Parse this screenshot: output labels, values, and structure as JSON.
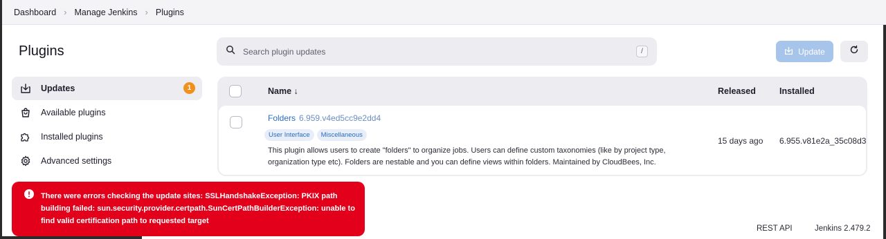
{
  "breadcrumb": [
    "Dashboard",
    "Manage Jenkins",
    "Plugins"
  ],
  "page_title": "Plugins",
  "sidebar": {
    "items": [
      {
        "label": "Updates",
        "icon": "download-icon",
        "badge": "1",
        "active": true
      },
      {
        "label": "Available plugins",
        "icon": "shopping-bag-icon"
      },
      {
        "label": "Installed plugins",
        "icon": "puzzle-icon"
      },
      {
        "label": "Advanced settings",
        "icon": "gear-icon"
      }
    ]
  },
  "search": {
    "placeholder": "Search plugin updates",
    "shortcut": "/"
  },
  "toolbar": {
    "update_label": "Update",
    "accent": "#a7c5ea"
  },
  "table": {
    "headers": {
      "name": "Name ↓",
      "released": "Released",
      "installed": "Installed"
    },
    "rows": [
      {
        "name": "Folders",
        "version": "6.959.v4ed5cc9e2dd4",
        "tags": [
          "User Interface",
          "Miscellaneous"
        ],
        "description": "This plugin allows users to create \"folders\" to organize jobs. Users can define custom taxonomies (like by project type, organization type etc). Folders are nestable and you can define views within folders. Maintained by CloudBees, Inc.",
        "released": "15 days ago",
        "installed": "6.955.v81e2a_35c08d3"
      }
    ]
  },
  "error": {
    "message": "There were errors checking the update sites: SSLHandshakeException: PKIX path building failed: sun.security.provider.certpath.SunCertPathBuilderException: unable to find valid certification path to requested target",
    "color": "#e3001b"
  },
  "footer": {
    "rest_api": "REST API",
    "version": "Jenkins 2.479.2"
  }
}
